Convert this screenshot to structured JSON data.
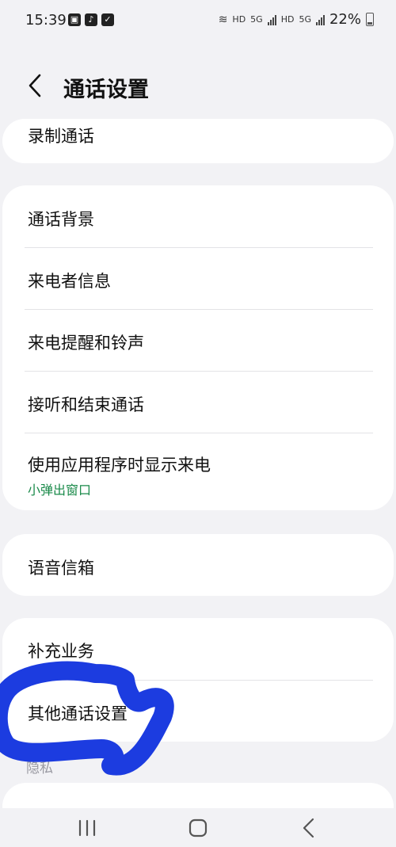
{
  "status_bar": {
    "time": "15:39",
    "battery": "22%",
    "network_labels": [
      "HD",
      "5G",
      "HD",
      "5G"
    ],
    "left_icons": [
      "gallery-icon",
      "tiktok-icon",
      "checkbox-icon"
    ]
  },
  "header": {
    "title": "通话设置"
  },
  "menu": {
    "record_calls": "录制通话",
    "call_background": "通话背景",
    "caller_info": "来电者信息",
    "ringtone": "来电提醒和铃声",
    "answer_end": "接听和结束通话",
    "show_while_using": "使用应用程序时显示来电",
    "show_while_using_sub": "小弹出窗口",
    "voicemail": "语音信箱",
    "supplementary": "补充业务",
    "other_settings": "其他通话设置"
  },
  "sections": {
    "privacy": "隐私"
  },
  "colors": {
    "accent_green": "#1a8a4a",
    "scribble_blue": "#1c3ce0",
    "background": "#f2f2f5"
  }
}
